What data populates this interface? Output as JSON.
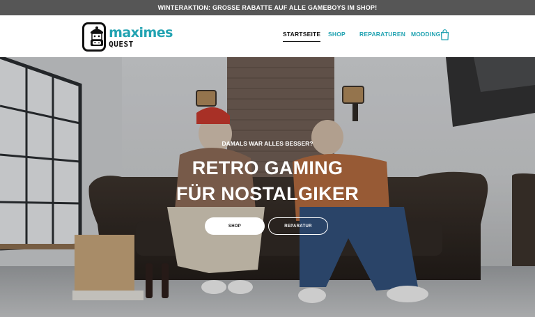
{
  "announcement": "WINTERAKTION: GROSSE RABATTE AUF ALLE GAMEBOYS IM SHOP!",
  "brand": {
    "line1": "maximes",
    "line2": "QUEST"
  },
  "nav": {
    "items": [
      {
        "label": "STARTSEITE",
        "active": true
      },
      {
        "label": "SHOP",
        "active": false
      },
      {
        "label": "REPARATUREN",
        "active": false
      },
      {
        "label": "MODDING",
        "active": false
      }
    ]
  },
  "colors": {
    "accent": "#22a3b2",
    "announcement_bg": "#565656",
    "text_dark": "#111111"
  },
  "icons": {
    "cart": "shopping-bag-icon",
    "logo": "retro-gamer-mascot-icon"
  },
  "hero": {
    "eyebrow": "DAMALS WAR ALLES BESSER?",
    "headline_line1": "RETRO GAMING",
    "headline_line2": "FÜR NOSTALGIKER",
    "primary_button": "SHOP",
    "secondary_button": "REPARATUR"
  }
}
